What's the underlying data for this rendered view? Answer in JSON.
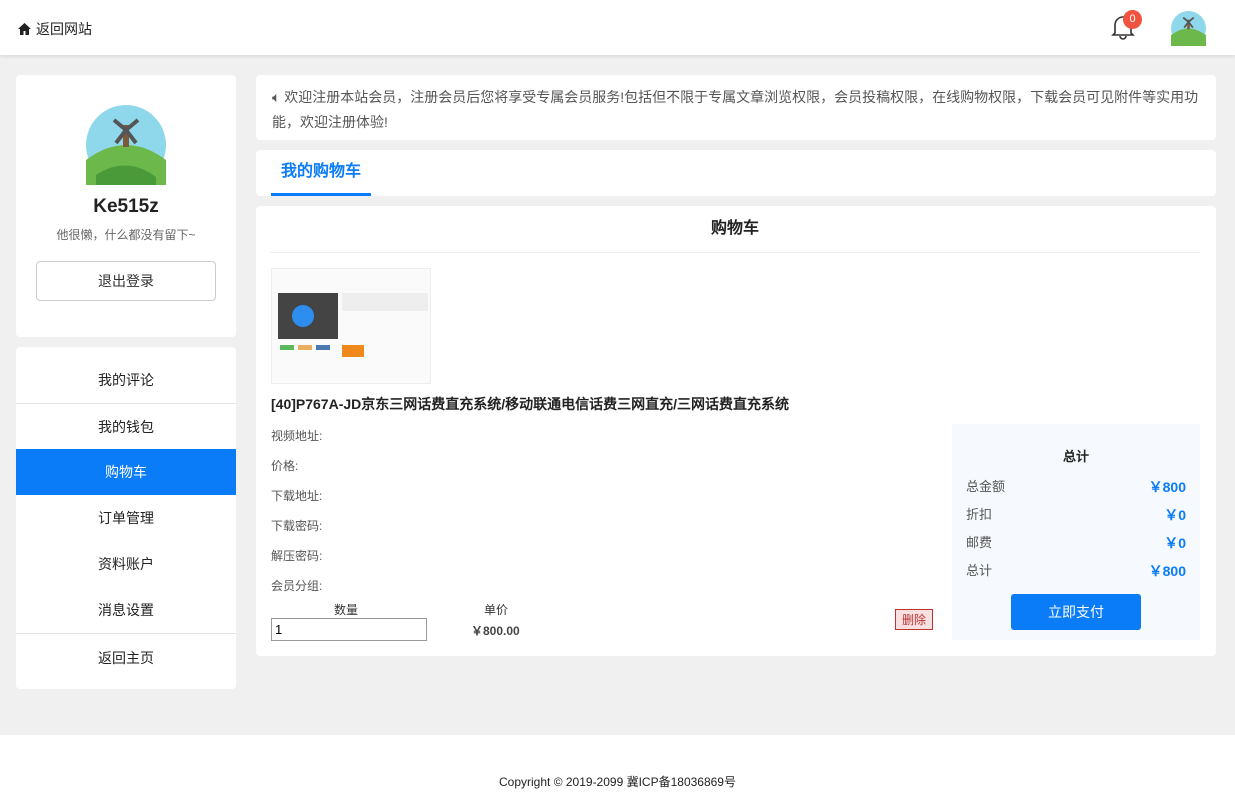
{
  "header": {
    "back_label": "返回网站",
    "notifications": "0"
  },
  "profile": {
    "name": "Ke515z",
    "bio": "他很懒，什么都没有留下~",
    "logout": "退出登录"
  },
  "menu": [
    "我的评论",
    "我的钱包",
    "购物车",
    "订单管理",
    "资料账户",
    "消息设置",
    "返回主页"
  ],
  "notice": "欢迎注册本站会员，注册会员后您将享受专属会员服务!包括但不限于专属文章浏览权限，会员投稿权限，在线购物权限，下载会员可见附件等实用功能，欢迎注册体验!",
  "tab": "我的购物车",
  "cart": {
    "title": "购物车",
    "product_title": "[40]P767A-JD京东三网话费直充系统/移动联通电信话费三网直充/三网话费直充系统",
    "fields": [
      "视频地址:",
      "价格:",
      "下载地址:",
      "下载密码:",
      "解压密码:",
      "会员分组:"
    ],
    "qty_label": "数量",
    "qty": "1",
    "price_label": "单价",
    "price": "￥800.00",
    "delete": "删除"
  },
  "summary": {
    "title": "总计",
    "rows": [
      {
        "label": "总金额",
        "value": "￥800"
      },
      {
        "label": "折扣",
        "value": "￥0"
      },
      {
        "label": "邮费",
        "value": "￥0"
      },
      {
        "label": "总计",
        "value": "￥800"
      }
    ],
    "pay": "立即支付"
  },
  "footer": "Copyright © 2019-2099   冀ICP备18036869号"
}
